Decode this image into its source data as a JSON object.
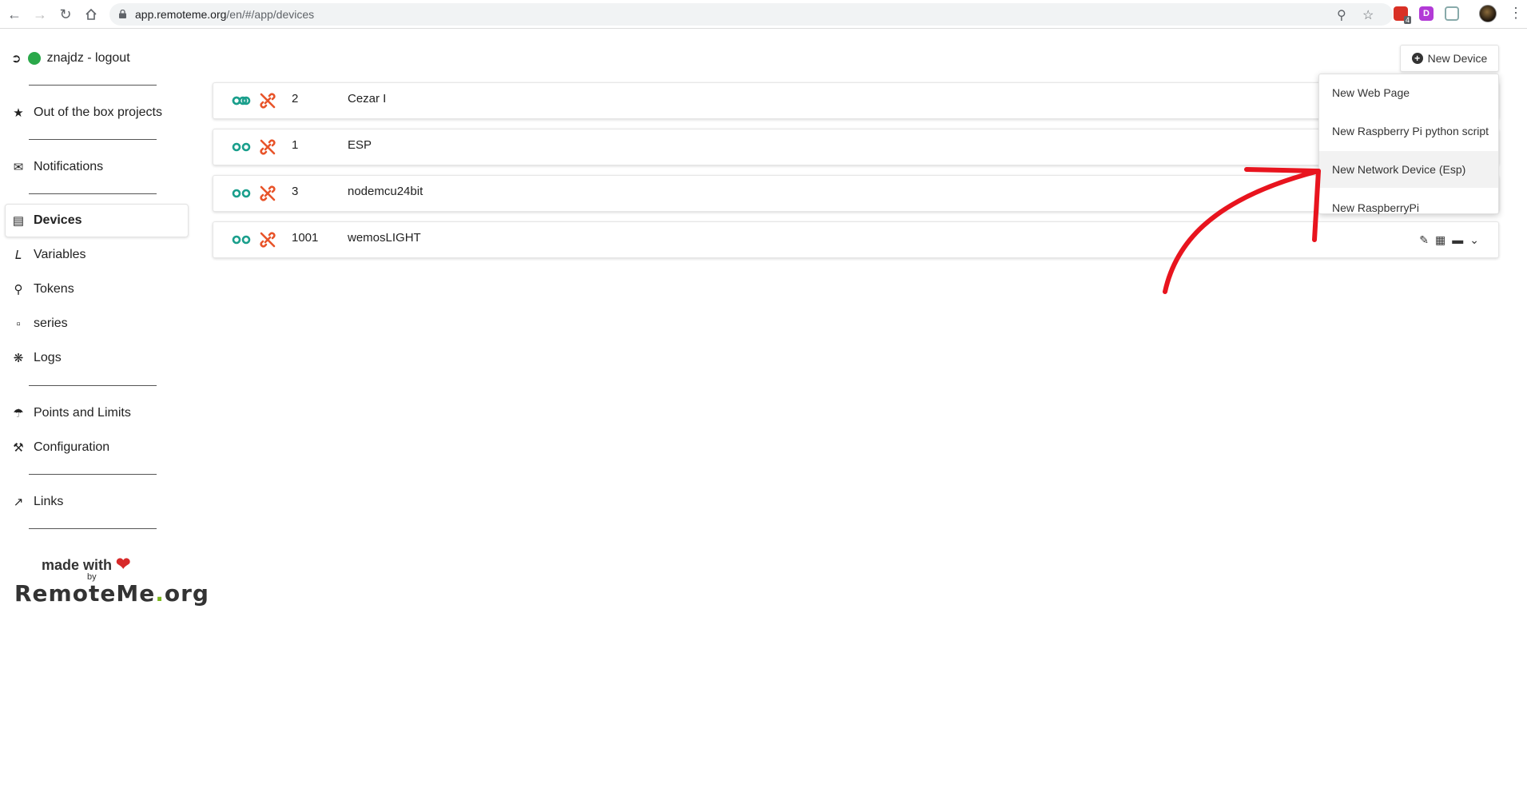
{
  "browser": {
    "url_host": "app.remoteme.org",
    "url_path": "/en/#/app/devices",
    "ext_badge": "4",
    "ext_letter": "D"
  },
  "sidebar": {
    "user_label": "znajdz - logout",
    "items": [
      {
        "label": "Out of the box projects",
        "icon": "star-icon"
      },
      {
        "label": "Notifications",
        "icon": "envelope-icon"
      },
      {
        "label": "Devices",
        "icon": "chip-icon"
      },
      {
        "label": "Variables",
        "icon": "variable-icon"
      },
      {
        "label": "Tokens",
        "icon": "key-icon"
      },
      {
        "label": "series",
        "icon": "bar-chart-icon"
      },
      {
        "label": "Logs",
        "icon": "bug-icon"
      },
      {
        "label": "Points and Limits",
        "icon": "trophy-icon"
      },
      {
        "label": "Configuration",
        "icon": "wrench-icon"
      },
      {
        "label": "Links",
        "icon": "external-link-icon"
      }
    ],
    "made_with": "made with",
    "by": "by",
    "logo_main": "RemoteMe",
    "logo_dot": ".",
    "logo_tld": "org"
  },
  "devices": [
    {
      "id": "2",
      "name": "Cezar I"
    },
    {
      "id": "1",
      "name": "ESP"
    },
    {
      "id": "3",
      "name": "nodemcu24bit"
    },
    {
      "id": "1001",
      "name": "wemosLIGHT"
    }
  ],
  "new_device": {
    "label": "New Device",
    "menu": [
      {
        "label": "New Web Page"
      },
      {
        "label": "New Raspberry Pi python script"
      },
      {
        "label": "New Network Device (Esp)"
      },
      {
        "label": "New RaspberryPi"
      }
    ]
  },
  "colors": {
    "link_green": "#1a9f8c",
    "unlink_orange": "#e8542a",
    "annotation_red": "#e8141e"
  }
}
